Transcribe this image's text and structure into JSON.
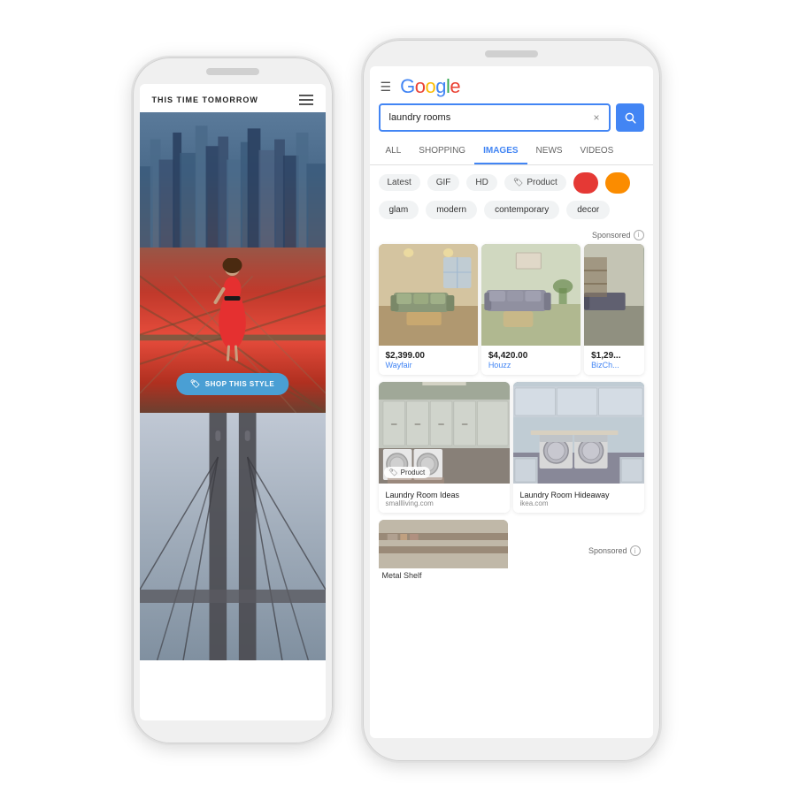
{
  "phones": {
    "left": {
      "blog_title": "THIS TIME TOMORROW",
      "shop_btn_label": "SHOP THIS STYLE"
    },
    "right": {
      "header": {
        "menu_label": "☰",
        "google_logo": "Google"
      },
      "search": {
        "query": "laundry rooms",
        "clear_icon": "×",
        "search_icon": "🔍"
      },
      "nav_tabs": [
        {
          "label": "ALL",
          "active": false
        },
        {
          "label": "SHOPPING",
          "active": false
        },
        {
          "label": "IMAGES",
          "active": true
        },
        {
          "label": "NEWS",
          "active": false
        },
        {
          "label": "VIDEOS",
          "active": false
        }
      ],
      "filters": [
        {
          "label": "Latest",
          "type": "text"
        },
        {
          "label": "GIF",
          "type": "text"
        },
        {
          "label": "HD",
          "type": "text"
        },
        {
          "label": "Product",
          "type": "product"
        },
        {
          "label": "red",
          "type": "color",
          "color": "red"
        },
        {
          "label": "orange",
          "type": "color",
          "color": "orange"
        }
      ],
      "suggestions": [
        "glam",
        "modern",
        "contemporary",
        "decor"
      ],
      "sponsored_label": "Sponsored",
      "grid_row1": [
        {
          "price": "$2,399.00",
          "store": "Wayfair",
          "room_type": "room1"
        },
        {
          "price": "$4,420.00",
          "store": "Houzz",
          "room_type": "room2"
        },
        {
          "price": "$1,29...",
          "store": "BizCh...",
          "room_type": "room3"
        }
      ],
      "grid_row2": [
        {
          "badge": "Product",
          "label": "Laundry Room Ideas",
          "source": "smallliving.com",
          "room_type": "laundry1"
        },
        {
          "label": "Laundry Room Hideaway",
          "source": "ikea.com",
          "room_type": "laundry2"
        }
      ],
      "bottom_partial": {
        "label": "Metal Shelf",
        "sponsored": "Sponsored"
      }
    }
  }
}
